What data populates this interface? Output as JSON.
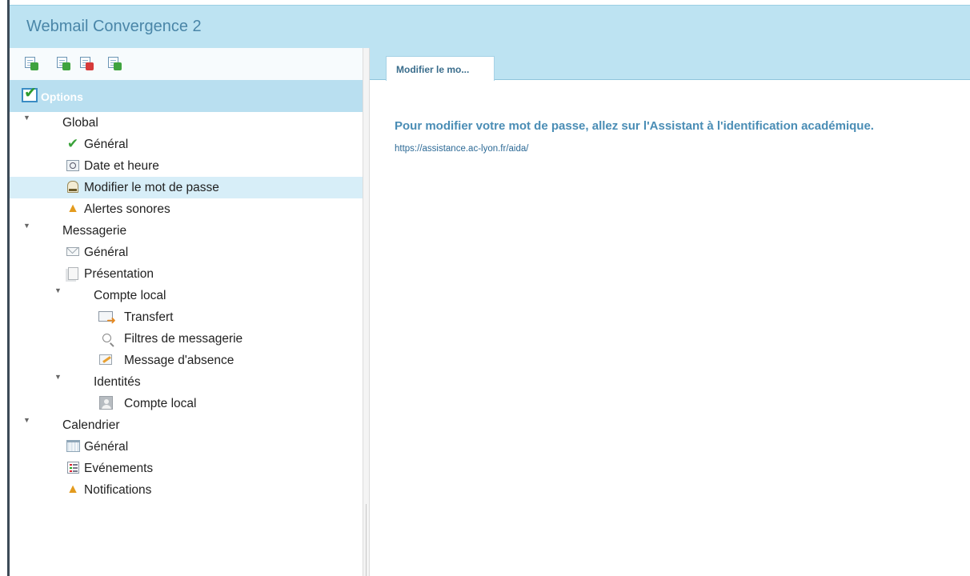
{
  "app": {
    "title": "Webmail Convergence 2"
  },
  "toolbar": {
    "buttons": [
      {
        "icon": "add-document-icon"
      },
      {
        "icon": "export-document-icon"
      },
      {
        "icon": "delete-document-icon"
      },
      {
        "icon": "import-document-icon"
      }
    ]
  },
  "sidebar": {
    "header": "Options",
    "tree": {
      "global": {
        "label": "Global",
        "items": {
          "general": {
            "label": "Général",
            "icon": "checkmark-icon"
          },
          "date": {
            "label": "Date et heure",
            "icon": "clock-icon"
          },
          "password": {
            "label": "Modifier le mot de passe",
            "icon": "key-icon",
            "selected": true
          },
          "sounds": {
            "label": "Alertes sonores",
            "icon": "bell-icon"
          }
        }
      },
      "messagerie": {
        "label": "Messagerie",
        "items": {
          "general": {
            "label": "Général",
            "icon": "envelope-icon"
          },
          "presentation": {
            "label": "Présentation",
            "icon": "pages-icon"
          }
        },
        "compte_local": {
          "label": "Compte local",
          "items": {
            "transfert": {
              "label": "Transfert",
              "icon": "forward-mail-icon"
            },
            "filtres": {
              "label": "Filtres de messagerie",
              "icon": "magnifier-icon"
            },
            "absence": {
              "label": "Message d'absence",
              "icon": "pencil-note-icon"
            }
          }
        },
        "identites": {
          "label": "Identités",
          "items": {
            "compte": {
              "label": "Compte local",
              "icon": "person-icon"
            }
          }
        }
      },
      "calendrier": {
        "label": "Calendrier",
        "items": {
          "general": {
            "label": "Général",
            "icon": "calendar-grid-icon"
          },
          "evenements": {
            "label": "Evénements",
            "icon": "list-icon"
          },
          "notifications": {
            "label": "Notifications",
            "icon": "bell-icon"
          }
        }
      }
    }
  },
  "main": {
    "tab_label": "Modifier le mo...",
    "heading": "Pour modifier votre mot de passe, allez sur l'Assistant à l'identification académique.",
    "link": "https://assistance.ac-lyon.fr/aida/"
  },
  "colors": {
    "header_bg": "#bde3f2",
    "title_text": "#4a86a8",
    "selected_row": "#d7eef8",
    "heading_text": "#4a8db5"
  }
}
